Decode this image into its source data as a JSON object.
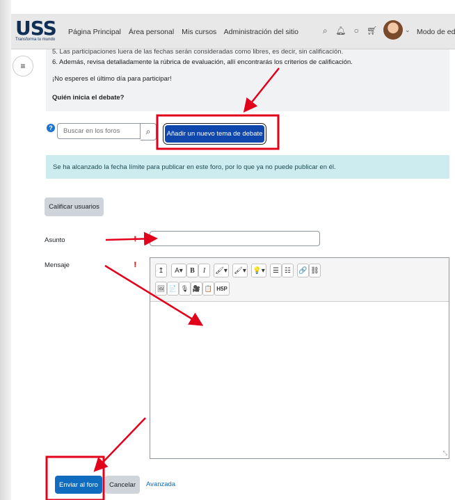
{
  "header": {
    "logo_text": "USS",
    "logo_tagline": "Transforma tu mundo",
    "nav": [
      "Página Principal",
      "Área personal",
      "Mis cursos",
      "Administración del sitio"
    ],
    "icons": [
      "search-icon",
      "bell-icon",
      "chat-icon",
      "cart-icon"
    ],
    "edit_mode_label": "Modo de edic"
  },
  "intro": {
    "line_5": "5. Las participaciones luera de las fechas serán consideradas como libres, es decir, sin calificación.",
    "line_6": "6. Además, revisa detalladamente la rúbrica de evaluación, allí encontrarás los criterios de calificación.",
    "reminder": "¡No esperes el último día para participar!",
    "question": "Quién inicia el debate?"
  },
  "search": {
    "placeholder": "Buscar en los foros"
  },
  "add_topic_label": "Añadir un nuevo tema de debate",
  "alert_text": "Se ha alcanzado la fecha límite para publicar en este foro, por lo que ya no puede publicar en él.",
  "grade_users_label": "Calificar usuarios",
  "form": {
    "subject_label": "Asunto",
    "message_label": "Mensaje",
    "subject_value": ""
  },
  "editor": {
    "toolbar_row1": [
      "↥",
      "A▾",
      "B",
      "I",
      "🖌▾",
      "🖌▾",
      "💡▾",
      "☰",
      "☷",
      "🔗",
      "⛓"
    ],
    "toolbar_row2": [
      "🖼",
      "📄",
      "🎙",
      "🎥",
      "📋",
      "H5P"
    ]
  },
  "actions": {
    "submit_label": "Enviar al foro",
    "cancel_label": "Cancelar",
    "advanced_label": "Avanzada"
  },
  "colors": {
    "primary": "#0f6cbf",
    "annotation": "#e3001b"
  }
}
